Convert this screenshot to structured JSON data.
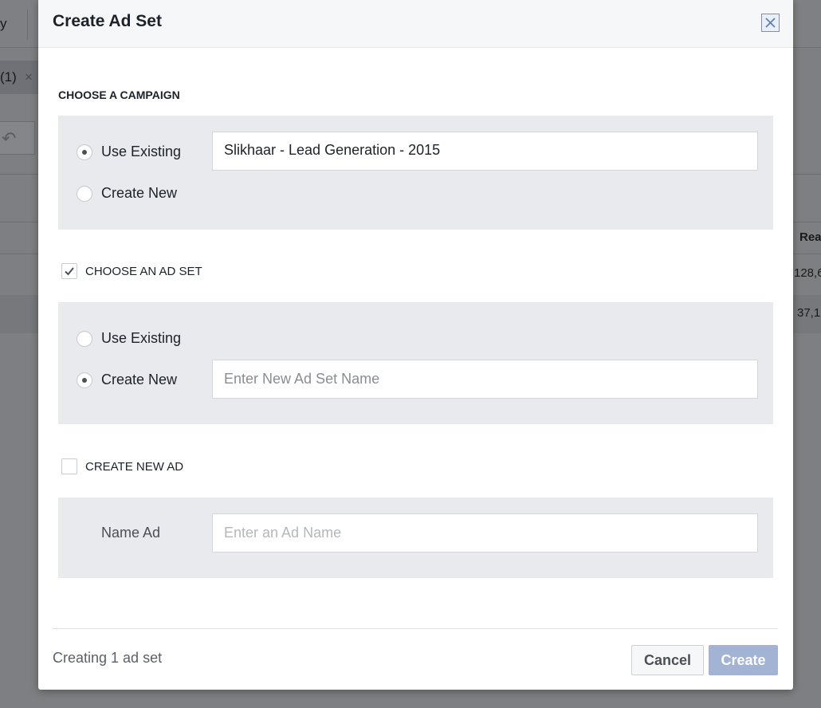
{
  "background": {
    "top_left_fragment": "y",
    "chip_text": "(1)",
    "chip_close": "×",
    "undo_glyph": "↶",
    "column_header_fragment": "Rea",
    "row1_fragment": "128,6",
    "row2_fragment": "37,1"
  },
  "modal": {
    "title": "Create Ad Set",
    "close_label": "×"
  },
  "campaign": {
    "section_label": "CHOOSE A CAMPAIGN",
    "use_existing_label": "Use Existing",
    "create_new_label": "Create New",
    "selected": "use_existing",
    "campaign_value": "Slikhaar - Lead Generation - 2015"
  },
  "ad_set": {
    "section_label": "CHOOSE AN AD SET",
    "checked": true,
    "use_existing_label": "Use Existing",
    "create_new_label": "Create New",
    "selected": "create_new",
    "name_placeholder": "Enter New Ad Set Name"
  },
  "new_ad": {
    "section_label": "CREATE NEW AD",
    "checked": false,
    "name_label": "Name Ad",
    "name_placeholder": "Enter an Ad Name"
  },
  "footer": {
    "status": "Creating 1 ad set",
    "cancel_label": "Cancel",
    "create_label": "Create"
  }
}
